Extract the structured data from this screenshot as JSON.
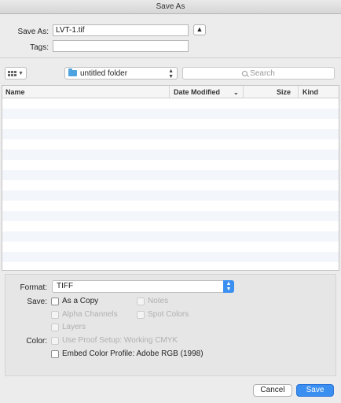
{
  "window": {
    "title": "Save As"
  },
  "save_as": {
    "label": "Save As:",
    "value": "LVT-1.tif"
  },
  "tags": {
    "label": "Tags:",
    "value": ""
  },
  "toolbar": {
    "view_icon": "grid-view-icon",
    "folder": "untitled folder",
    "search_placeholder": "Search"
  },
  "file_list": {
    "columns": [
      "Name",
      "Date Modified",
      "Size",
      "Kind"
    ],
    "sort_indicator": "chevron-down-icon",
    "rows": []
  },
  "options": {
    "format_label": "Format:",
    "format_value": "TIFF",
    "save_label": "Save:",
    "color_label": "Color:",
    "checkboxes": {
      "as_a_copy": "As a Copy",
      "notes": "Notes",
      "alpha_channels": "Alpha Channels",
      "spot_colors": "Spot Colors",
      "layers": "Layers",
      "use_proof_setup": "Use Proof Setup:  Working CMYK",
      "embed_color_profile": "Embed Color Profile:  Adobe RGB (1998)"
    }
  },
  "buttons": {
    "cancel": "Cancel",
    "save": "Save"
  },
  "colors": {
    "accent": "#3b8ff0",
    "folder": "#4da3e0"
  }
}
